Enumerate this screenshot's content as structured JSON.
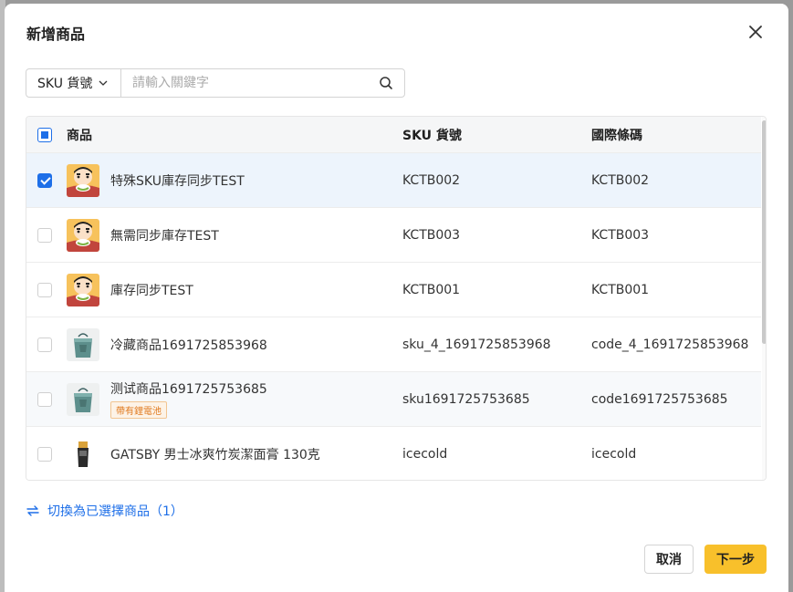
{
  "dialog": {
    "title": "新增商品",
    "close_icon": "close-icon"
  },
  "search": {
    "field_selector": "SKU 貨號",
    "placeholder": "請輸入關鍵字",
    "value": ""
  },
  "table": {
    "headers": {
      "product": "商品",
      "sku": "SKU 貨號",
      "barcode": "國際條碼"
    },
    "select_all_state": "indeterminate",
    "rows": [
      {
        "name": "特殊SKU庫存同步TEST",
        "sku": "KCTB002",
        "barcode": "KCTB002",
        "checked": true,
        "thumb": "cartoon-avatar",
        "tag": ""
      },
      {
        "name": "無需同步庫存TEST",
        "sku": "KCTB003",
        "barcode": "KCTB003",
        "checked": false,
        "thumb": "cartoon-avatar",
        "tag": ""
      },
      {
        "name": "庫存同步TEST",
        "sku": "KCTB001",
        "barcode": "KCTB001",
        "checked": false,
        "thumb": "cartoon-avatar",
        "tag": ""
      },
      {
        "name": "冷藏商品1691725853968",
        "sku": "sku_4_1691725853968",
        "barcode": "code_4_1691725853968",
        "checked": false,
        "thumb": "cooler-bag",
        "tag": ""
      },
      {
        "name": "测试商品1691725753685",
        "sku": "sku1691725753685",
        "barcode": "code1691725753685",
        "checked": false,
        "thumb": "cooler-bag",
        "tag": "帶有鋰電池"
      },
      {
        "name": "GATSBY 男士冰爽竹炭潔面膏 130克",
        "sku": "icecold",
        "barcode": "icecold",
        "checked": false,
        "thumb": "facial-wash-tube",
        "tag": ""
      }
    ]
  },
  "footer": {
    "toggle_label": "切換為已選擇商品（1）",
    "cancel_label": "取消",
    "next_label": "下一步"
  },
  "colors": {
    "accent": "#1e6fe8",
    "primary_button": "#f8c02b",
    "selected_row": "#edf4fc",
    "tag_text": "#e07a1f"
  }
}
